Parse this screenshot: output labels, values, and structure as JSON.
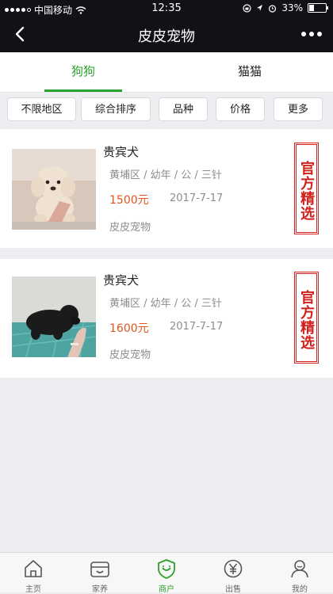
{
  "status": {
    "carrier": "中国移动",
    "time": "12:35",
    "battery": "33%"
  },
  "nav": {
    "title": "皮皮宠物"
  },
  "tabs": [
    {
      "label": "狗狗"
    },
    {
      "label": "猫猫"
    }
  ],
  "filters": [
    "不限地区",
    "综合排序",
    "品种",
    "价格",
    "更多"
  ],
  "listings": [
    {
      "name": "贵宾犬",
      "meta": "黄埔区 / 幼年 / 公 / 三针",
      "price": "1500元",
      "date": "2017-7-17",
      "shop": "皮皮宠物",
      "stamp": "官方精选"
    },
    {
      "name": "贵宾犬",
      "meta": "黄埔区 / 幼年 / 公 / 三针",
      "price": "1600元",
      "date": "2017-7-17",
      "shop": "皮皮宠物",
      "stamp": "官方精选"
    }
  ],
  "bottom_nav": [
    {
      "label": "主页",
      "icon": "home-icon"
    },
    {
      "label": "家养",
      "icon": "household-icon"
    },
    {
      "label": "商户",
      "icon": "merchant-shield-icon"
    },
    {
      "label": "出售",
      "icon": "yen-icon"
    },
    {
      "label": "我的",
      "icon": "profile-icon"
    }
  ],
  "colors": {
    "accent": "#2ca02c",
    "price": "#e2541d",
    "stamp": "#d0211c",
    "header": "#141017"
  }
}
